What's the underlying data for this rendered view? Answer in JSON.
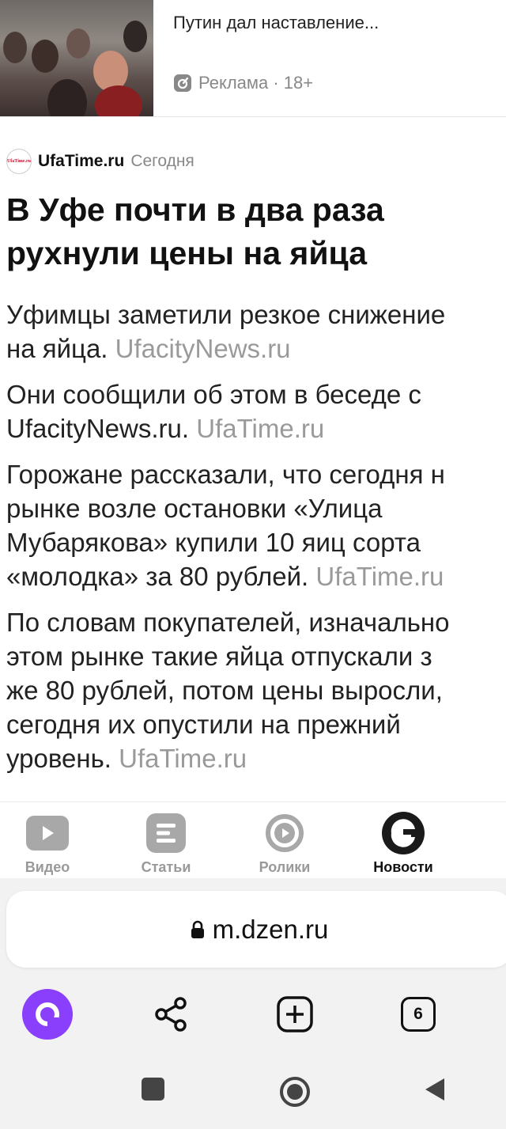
{
  "ad": {
    "title": "Путин дал наставление...",
    "meta": "Реклама · 18+",
    "icon": "ad-badge-icon"
  },
  "article": {
    "source_name": "UfaTime.ru",
    "source_logo_text": "UfaTime.ru",
    "date": "Сегодня",
    "headline_lines": [
      "В Уфе почти в два раза",
      "рухнули цены на яйца"
    ],
    "paragraphs": [
      {
        "lines": [
          "Уфимцы заметили резкое снижение",
          "на яйца."
        ],
        "source": "UfacityNews.ru"
      },
      {
        "lines": [
          "Они сообщили об этом в беседе с",
          "UfacityNews.ru."
        ],
        "source": "UfaTime.ru"
      },
      {
        "lines": [
          "Горожане рассказали, что сегодня н",
          "рынке возле остановки «Улица",
          "Мубарякова» купили 10 яиц сорта",
          "«молодка» за 80 рублей."
        ],
        "source": "UfaTime.ru"
      },
      {
        "lines": [
          "По словам покупателей, изначально",
          "этом рынке такие яйца отпускали з",
          "же 80 рублей, потом цены выросли,",
          "сегодня их опустили на прежний",
          "уровень."
        ],
        "source": "UfaTime.ru"
      }
    ]
  },
  "tabs": [
    {
      "label": "Видео",
      "icon": "video-play-icon",
      "active": false
    },
    {
      "label": "Статьи",
      "icon": "articles-icon",
      "active": false
    },
    {
      "label": "Ролики",
      "icon": "clips-icon",
      "active": false
    },
    {
      "label": "Новости",
      "icon": "news-icon",
      "active": true
    }
  ],
  "browser": {
    "url": "m.dzen.ru",
    "tabs_count": "6",
    "accent": "#8a3ffc"
  }
}
